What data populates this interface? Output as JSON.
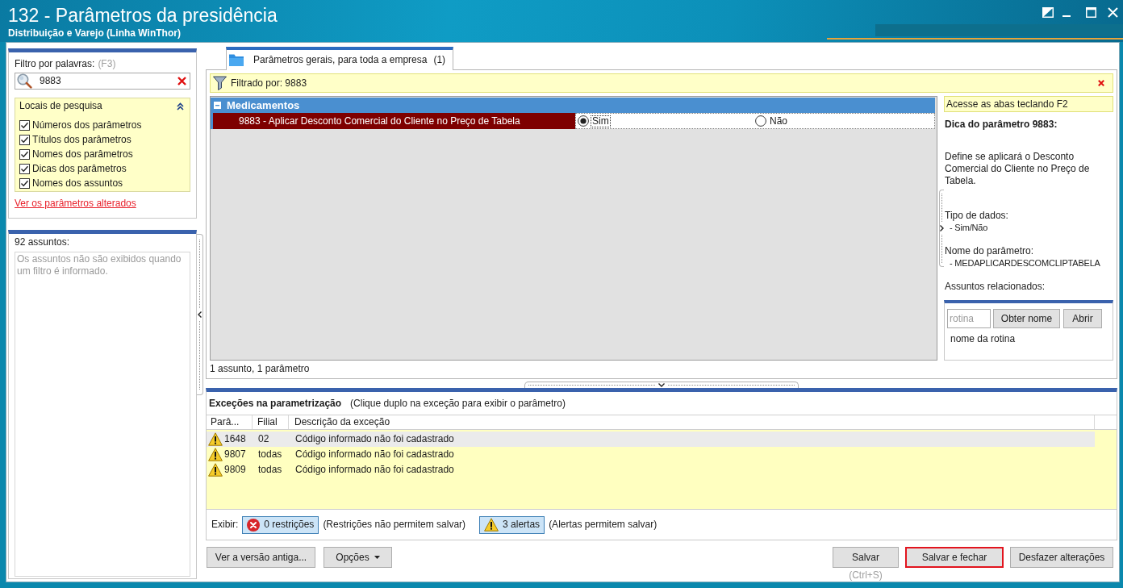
{
  "window": {
    "title": "132 - Parâmetros da presidência",
    "subtitle": "Distribuição e Varejo (Linha WinThor)"
  },
  "filter_panel": {
    "label": "Filtro por palavras:",
    "shortcut": "(F3)",
    "search": {
      "value": "9883"
    },
    "search_locations": {
      "title": "Locais de pesquisa",
      "expanded": true,
      "options": [
        {
          "label": "Números dos parâmetros",
          "checked": true
        },
        {
          "label": "Títulos dos parâmetros",
          "checked": true
        },
        {
          "label": "Nomes dos parâmetros",
          "checked": true
        },
        {
          "label": "Dicas dos parâmetros",
          "checked": true
        },
        {
          "label": "Nomes dos assuntos",
          "checked": true
        }
      ]
    },
    "link": "Ver os parâmetros alterados"
  },
  "subjects_panel": {
    "count": "92 assuntos:",
    "message": "Os assuntos não são exibidos quando um filtro é informado."
  },
  "tabs": [
    {
      "label": "Parâmetros gerais, para toda a empresa",
      "count": "(1)",
      "selected": true
    }
  ],
  "filter_bar": {
    "text": "Filtrado por: 9883"
  },
  "parameter_groups": [
    {
      "name": "Medicamentos",
      "expanded": true,
      "parameters": [
        {
          "label": "9883 - Aplicar Desconto Comercial do Cliente no Preço de Tabela",
          "selected": true,
          "options": [
            {
              "label": "Sim",
              "selected": true
            },
            {
              "label": "Não",
              "selected": false
            }
          ]
        }
      ]
    }
  ],
  "summary": "1 assunto, 1 parâmetro",
  "hint_panel": {
    "notice": "Acesse as abas teclando F2",
    "title": "Dica do parâmetro 9883:",
    "description": "Define se aplicará o Desconto Comercial do Cliente no Preço de Tabela.",
    "sections": [
      {
        "heading": "Tipo de dados:",
        "value": "- Sim/Não"
      },
      {
        "heading": "Nome do parâmetro:",
        "value": "- MEDAPLICARDESCOMCLIPTABELA"
      },
      {
        "heading": "Assuntos relacionados:"
      }
    ]
  },
  "routine_panel": {
    "placeholder": "rotina",
    "buttons": [
      "Obter nome",
      "Abrir"
    ],
    "label": "nome da rotina"
  },
  "exceptions": {
    "title": "Exceções na parametrização",
    "hint": "(Clique duplo na exceção para exibir o parâmetro)",
    "columns": [
      "Parâ...",
      "Filial",
      "Descrição da exceção"
    ],
    "rows": [
      {
        "kind": "alert",
        "parameter": "1648",
        "branch": "02",
        "description": "Código informado não foi cadastrado",
        "selected": true
      },
      {
        "kind": "alert",
        "parameter": "9807",
        "branch": "todas",
        "description": "Código informado não foi cadastrado",
        "selected": false
      },
      {
        "kind": "alert",
        "parameter": "9809",
        "branch": "todas",
        "description": "Código informado não foi cadastrado",
        "selected": false
      }
    ],
    "show_label": "Exibir:",
    "toggles": [
      {
        "kind": "restriction",
        "label": "0 restrições",
        "on": true,
        "note": "(Restrições não permitem salvar)"
      },
      {
        "kind": "alert",
        "label": "3 alertas",
        "on": true,
        "note": "(Alertas permitem salvar)"
      }
    ]
  },
  "buttons_left": [
    {
      "label": "Ver a versão antiga...",
      "kind": "plain"
    },
    {
      "label": "Opções",
      "kind": "menu"
    }
  ],
  "buttons_right": [
    {
      "label": "Salvar",
      "shortcut": "(Ctrl+S)",
      "focused": false
    },
    {
      "label": "Salvar e fechar",
      "focused": true
    },
    {
      "label": "Desfazer alterações",
      "focused": false
    }
  ]
}
